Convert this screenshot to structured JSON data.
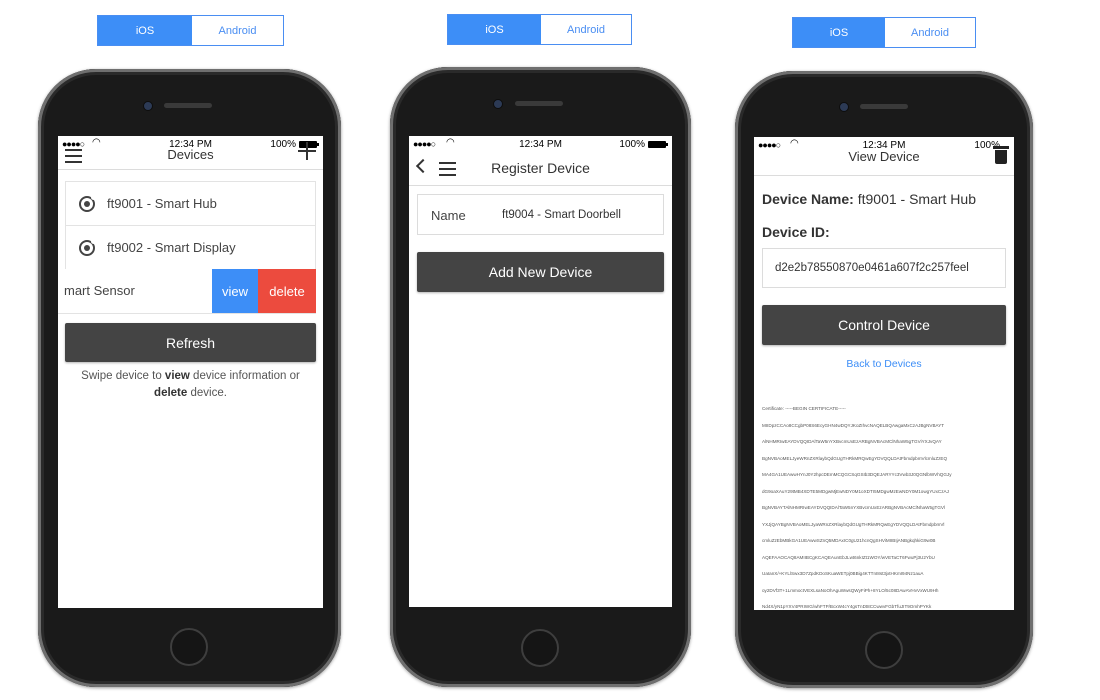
{
  "platform_toggles": [
    {
      "ios": "iOS",
      "android": "Android"
    },
    {
      "ios": "iOS",
      "android": "Android"
    },
    {
      "ios": "iOS",
      "android": "Android"
    }
  ],
  "status_bar": {
    "signal": "●●●●○",
    "time": "12:34 PM",
    "battery": "100%"
  },
  "screen1": {
    "title": "Devices",
    "devices": [
      "ft9001 - Smart Hub",
      "ft9002 - Smart Display"
    ],
    "swiped_item": "mart Sensor",
    "view_label": "view",
    "delete_label": "delete",
    "refresh_label": "Refresh",
    "helper": {
      "pre": "Swipe device to ",
      "view": "view",
      "mid": " device information or",
      "delete": "delete",
      "post": " device."
    }
  },
  "screen2": {
    "title": "Register Device",
    "name_label": "Name",
    "name_value": "ft9004 - Smart Doorbell",
    "add_label": "Add New Device"
  },
  "screen3": {
    "title": "View Device",
    "device_name_label": "Device Name:",
    "device_name_value": "ft9001 - Smart Hub",
    "device_id_label": "Device ID:",
    "device_id_value": "d2e2b78550870e0461a607f2c257feel",
    "control_label": "Control Device",
    "back_link": "Back to Devices",
    "certificate_lines": [
      "Certificate: -----BEGIN CERTIFICATE-----",
      "MIIDpzCCAo8CCgbP08S6EcyGHN4wDQYJKoZIhvcNAQELBQAwgaMxCzAJBgNVBAYT",
      "AlNHMRIwEAYDVQQIDAlTaW5nYXBvcmUxEzARBgNVBAcMClNhaW5gTGViYXJvQAY",
      "BgNVBAoMELJyeWRnZXRlaybQdGUgTHRkMRQwEgYDVQQLDAtFbmdpbmVlcmluZzEQ",
      "MA4GA1UEAwwHYnJ0Y2hpcDEmMCQGCSqGSIb3DQEJARYYc3Vwb3J0QGNlbWVhQGJy",
      "dG9oaXAuY29tMB4XDTE5MDgwMjEwNDY0M1oXDTI5MDgwMzEwNDY0M1owgYUxCzAJ",
      "BgNVBAYTAlNHMRIwEAYDVQQIDAlTaW5nYXBvcmUxEzARBgNVBAcMClNhaW5gTGVl",
      "YXJjQAYBgNVBAoMELJyaWRnZXRlaybQdGUgTHRkMRQwEgYDVQQLDAtFbmdpbmVl",
      "cmluZzEbMBkGA1UEAwwSZnQ5MDAxIC0gU21hcnQgSHViMIIBIjANBgkqhkiG9w0B",
      "AQEFAAOCAQ8AMIIBCgKCAQEAunEbJLwt6nkIZt1WOY/wVETaCT6FwuPj3U2YbU",
      "UaIanX/+KYLlSwx3D7ZpdKDoSKuaWETpj0BBig4KTTnI8st3jxtHKmI94Nz1auA",
      "oy2DVf3T+1LmmoctVEXLsaNoOhAguWwsQWyFiPh+8YLO/5c08DAwAVHvVxWU9Hh",
      "Nd4X/yN1pYXV4PRIWG/whFTP/BcxW4cY4gsTnDt8CCwwvFGbTfuJIT9OmhPYKk"
    ]
  }
}
